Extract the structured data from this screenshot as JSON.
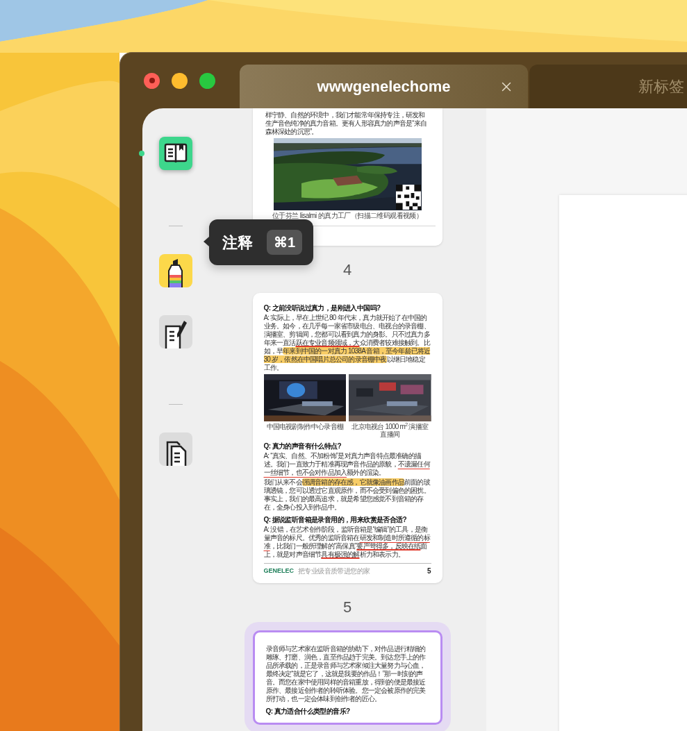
{
  "window": {
    "tabs": [
      {
        "title": "wwwgenelechome",
        "selected": true
      },
      {
        "title": "新标签",
        "selected": false
      }
    ]
  },
  "sidebar": {
    "items": [
      {
        "kind": "toc",
        "selected": true
      },
      {
        "kind": "separator"
      },
      {
        "kind": "annotate",
        "selected": false
      },
      {
        "kind": "notes",
        "selected": false
      },
      {
        "kind": "separator"
      },
      {
        "kind": "pages",
        "selected": false
      }
    ]
  },
  "tooltip": {
    "label": "注释",
    "shortcut": "⌘1"
  },
  "thumbnails": [
    {
      "page_label": "4",
      "selected": false,
      "blocks": [
        {
          "kind": "paragraph",
          "segments": [
            {
              "kind": "plain",
              "text": "样宁静、自然的环境中，我们才能常年保持专注，研发和生产音色纯净的真力音箱。更有人形容真力的声音是“来自森林深处的沉思”。"
            }
          ]
        },
        {
          "qr": true,
          "caption": "位于芬兰 Iisalmi 的真力工厂（扫描二维码观看视频）"
        },
        {
          "kind": "rule"
        }
      ]
    },
    {
      "page_label": "5",
      "selected": false,
      "blocks": [
        {
          "kind": "heading",
          "text": "Q: 之前没听说过真力，是刚进入中国吗?"
        },
        {
          "kind": "paragraph",
          "segments": [
            {
              "kind": "plain",
              "text": "A: 实际上，早在上世纪 80 年代末，真力就开始了在中国的业务。如今，在几乎每一家省市级电台、电视台的录音棚、演播室、剪辑间，您都可以看到真力的身影。只不过真力多年来一直活"
            },
            {
              "kind": "strike",
              "text": "跃在专业音频领域，大"
            },
            {
              "kind": "plain",
              "text": "众消费者较难接触到。比如，早"
            },
            {
              "kind": "highlight",
              "text": "年来到中国的一对真力 1038A 音箱，至今年龄已将近 30 岁，依然在中国唱片总公司的录音棚中夜"
            },
            {
              "kind": "plain",
              "text": "以继日地稳定工作。"
            }
          ]
        },
        {
          "kind": "image_pair",
          "captions": [
            "中国电视剧制作中心录音棚",
            "北京电视台 1000 m$^{2}$ 演播室直播间"
          ]
        },
        {
          "kind": "heading",
          "text": "Q: 真力的声音有什么特点?"
        },
        {
          "kind": "paragraph",
          "segments": [
            {
              "kind": "plain",
              "text": "A: “真实、自然、不加粉饰”是对真力声音特点最准确的描述。我们一直致力于精准再现声音作品的原貌，"
            },
            {
              "kind": "underline",
              "text": "不遗漏任何一丝细节，也不会对作品加入"
            },
            {
              "kind": "plain",
              "text": "额外的渲染。"
            }
          ]
        },
        {
          "kind": "paragraph",
          "segments": [
            {
              "kind": "plain",
              "text": "我们从来不会"
            },
            {
              "kind": "highlight",
              "text": "强调音箱的存在感，它就像油画作品"
            },
            {
              "kind": "plain",
              "text": "前面的玻璃透镜，您可以透过它直观原作，而不会受到偏色的困扰。事实上，我们的最高追求，就是希望您感觉不到音箱的存在，全身心投入到作品中。"
            }
          ]
        },
        {
          "kind": "heading",
          "text": "Q: 据说监听音箱是录音用的，用来欣赏是否合适?"
        },
        {
          "kind": "paragraph",
          "segments": [
            {
              "kind": "plain",
              "text": "A: 没错，在艺术创作阶段，监听音箱是“编辑”的工具，是衡量声音的标尺。优秀的监听音箱在"
            },
            {
              "kind": "underline",
              "text": "研发和制造时所遵循的标准"
            },
            {
              "kind": "plain",
              "text": "，比我们一般所理解的“高保真”"
            },
            {
              "kind": "strike",
              "text": "要严苛得多，反映在纸"
            },
            {
              "kind": "plain",
              "text": "面上，就是对声音细节"
            },
            {
              "kind": "strike",
              "text": "具有极强的解"
            },
            {
              "kind": "plain",
              "text": "析力和表示力。"
            }
          ]
        },
        {
          "kind": "footer",
          "brand": "GENELEC",
          "tagline": "把专业级音质带进您的家",
          "number": "5"
        }
      ]
    },
    {
      "selected": true,
      "blocks": [
        {
          "kind": "paragraph",
          "segments": [
            {
              "kind": "plain",
              "text": "录音师与艺术家在监听音箱的协助下，对作品进行精细的雕琢、打磨、润色，直至作品趋于完美。到达您手上的作品所承载的，正是录音师与艺术家倾注大量努力与心血，最终决定“就是它了，这就是我要的作品！”那一时刻的声音。而您在家中使用同样的音箱重放，得到的便是最接近原作、最接近创作者的聆听体验。您一定会被原作的完美所打动，也一定会体味到创作者的匠心。"
            }
          ]
        },
        {
          "kind": "heading",
          "text": "Q: 真力适合什么类型的音乐?"
        }
      ]
    }
  ]
}
